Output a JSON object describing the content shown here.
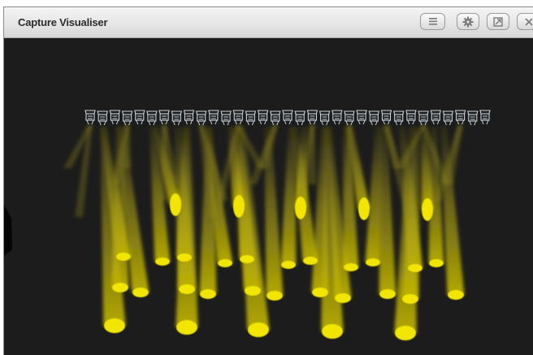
{
  "window": {
    "title": "Capture Visualiser",
    "buttons": [
      {
        "name": "menu-button",
        "icon": "menu-lines-icon"
      },
      {
        "name": "settings-button",
        "icon": "gear-icon"
      },
      {
        "name": "restore-button",
        "icon": "restore-window-icon"
      },
      {
        "name": "close-button",
        "icon": "close-icon"
      }
    ]
  },
  "scene": {
    "background": "#1c1c1c",
    "beam_color": "#f2e600",
    "fixture_color": "#c9d4dc",
    "fixture_count": 33,
    "spot_count": 36
  }
}
